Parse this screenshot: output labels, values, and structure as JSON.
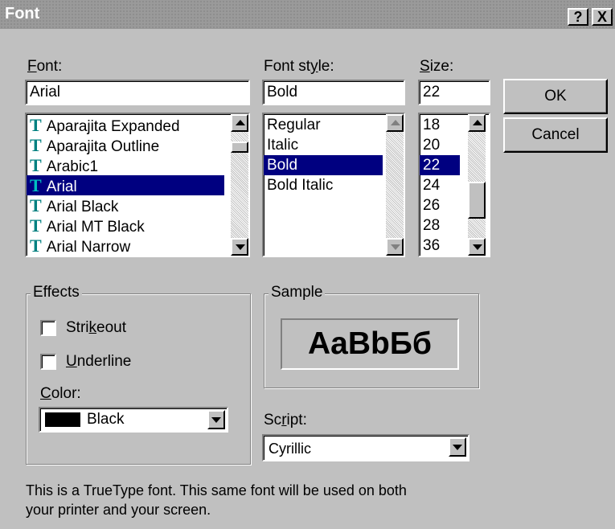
{
  "window": {
    "title": "Font",
    "help_label": "?",
    "close_label": "X"
  },
  "font": {
    "label": "Font:",
    "value": "Arial",
    "items": [
      {
        "label": "Aparajita Expanded",
        "icon": "truetype-icon"
      },
      {
        "label": "Aparajita Outline",
        "icon": "truetype-icon"
      },
      {
        "label": "Arabic1",
        "icon": "truetype-icon"
      },
      {
        "label": "Arial",
        "icon": "truetype-icon",
        "selected": true
      },
      {
        "label": "Arial Black",
        "icon": "truetype-icon"
      },
      {
        "label": "Arial MT Black",
        "icon": "truetype-icon"
      },
      {
        "label": "Arial Narrow",
        "icon": "truetype-icon"
      }
    ]
  },
  "style": {
    "label": "Font style:",
    "value": "Bold",
    "items": [
      "Regular",
      "Italic",
      "Bold",
      "Bold Italic"
    ],
    "selected_index": 2
  },
  "size": {
    "label": "Size:",
    "value": "22",
    "items": [
      "18",
      "20",
      "22",
      "24",
      "26",
      "28",
      "36"
    ],
    "selected_index": 2
  },
  "buttons": {
    "ok": "OK",
    "cancel": "Cancel"
  },
  "effects": {
    "label": "Effects",
    "strikeout": "Strikeout",
    "underline": "Underline",
    "color_label": "Color:",
    "color_value": "Black",
    "color_swatch": "#000000"
  },
  "sample": {
    "label": "Sample",
    "text": "AaBbБб"
  },
  "script": {
    "label": "Script:",
    "value": "Cyrillic"
  },
  "description": {
    "line1": "This is a TrueType font. This same font will be used on both",
    "line2": "your printer and your screen."
  },
  "colors": {
    "dialog_bg": "#c0c0c0",
    "selection": "#000080",
    "truetype_icon": "#008080"
  }
}
